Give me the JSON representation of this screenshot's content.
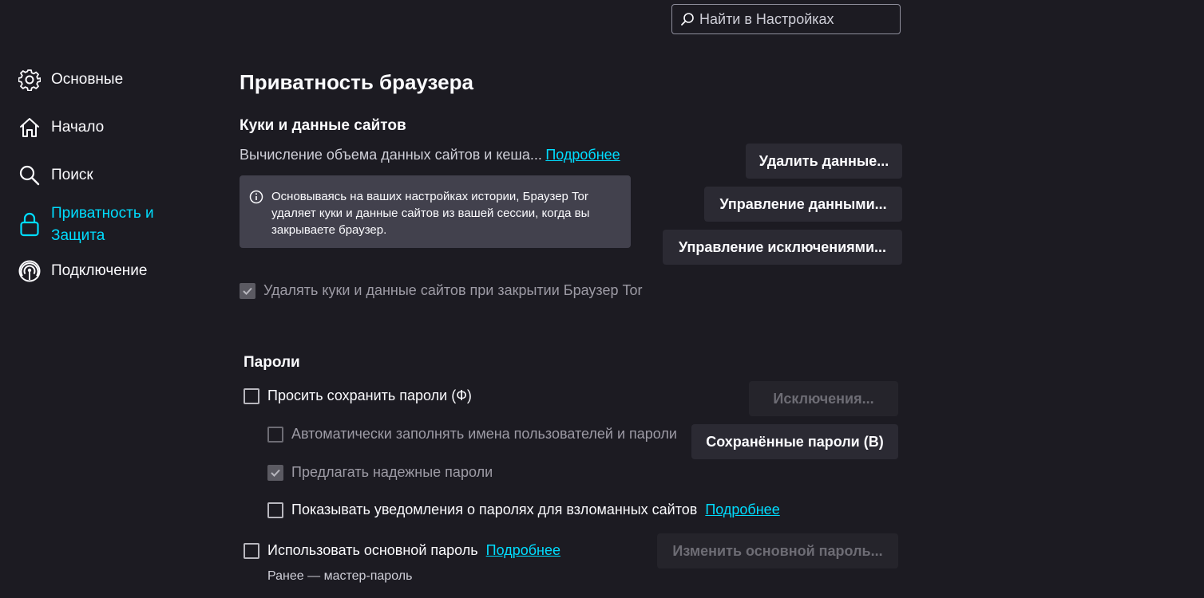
{
  "search": {
    "placeholder": "Найти в Настройках"
  },
  "sidebar": {
    "items": [
      {
        "label": "Основные",
        "icon": "gear-icon"
      },
      {
        "label": "Начало",
        "icon": "home-icon"
      },
      {
        "label": "Поиск",
        "icon": "search-icon"
      },
      {
        "label": "Приватность и Защита",
        "icon": "lock-icon",
        "selected": true
      },
      {
        "label": "Подключение",
        "icon": "connection-icon"
      }
    ]
  },
  "page": {
    "title": "Приватность браузера"
  },
  "cookies": {
    "title": "Куки и данные сайтов",
    "status": "Вычисление объема данных сайтов и кеша...",
    "learn_more": "Подробнее",
    "info": "Основываясь на ваших настройках истории, Браузер Tor удаляет куки и данные сайтов из вашей сессии, когда вы закрываете браузер.",
    "buttons": {
      "clear": "Удалить данные...",
      "manage_data": "Управление данными...",
      "manage_exceptions": "Управление исключениями..."
    },
    "delete_on_close": {
      "label": "Удалять куки и данные сайтов при закрытии Браузер Tor",
      "checked": true,
      "disabled": true
    }
  },
  "passwords": {
    "title": "Пароли",
    "ask_save": {
      "label": "Просить сохранить пароли (Ф)",
      "checked": false
    },
    "exceptions_button": "Исключения...",
    "autofill": {
      "label": "Автоматически заполнять имена пользователей и пароли",
      "checked": false,
      "disabled": true
    },
    "saved_button": "Сохранённые пароли (В)",
    "suggest": {
      "label": "Предлагать надежные пароли",
      "checked": true,
      "disabled": true
    },
    "breach_alerts": {
      "label": "Показывать уведомления о паролях для взломанных сайтов",
      "checked": false
    },
    "breach_learn_more": "Подробнее",
    "primary_password": {
      "label": "Использовать основной пароль",
      "checked": false
    },
    "primary_learn_more": "Подробнее",
    "change_primary_button": "Изменить основной пароль...",
    "formerly": "Ранее — мастер-пароль"
  },
  "colors": {
    "accent": "#00ddff",
    "background": "#1c1b22",
    "button": "#2b2a33",
    "infobox": "#42414d"
  }
}
